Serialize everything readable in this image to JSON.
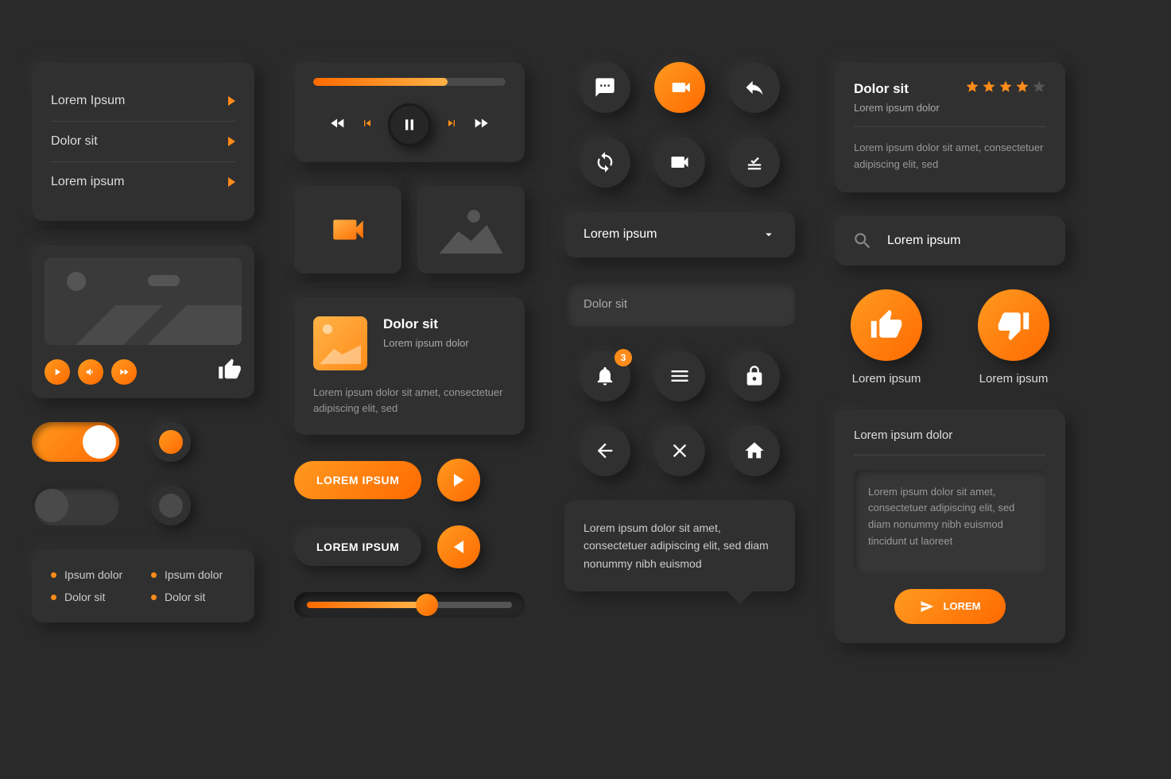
{
  "menu": {
    "items": [
      "Lorem Ipsum",
      "Dolor sit",
      "Lorem ipsum"
    ]
  },
  "bullets": [
    "Ipsum dolor",
    "Ipsum dolor",
    "Dolor sit",
    "Dolor sit"
  ],
  "player": {
    "progress": 70
  },
  "post": {
    "title": "Dolor sit",
    "subtitle": "Lorem ipsum dolor",
    "body": "Lorem ipsum dolor sit amet, consectetuer adipiscing elit, sed"
  },
  "buttons": {
    "primary": "LOREM IPSUM",
    "secondary": "LOREM IPSUM"
  },
  "slider": {
    "value": 55
  },
  "dropdown": {
    "label": "Lorem ipsum"
  },
  "input": {
    "placeholder": "Dolor sit"
  },
  "notification_badge": "3",
  "tooltip": "Lorem ipsum dolor sit amet, consectetuer adipiscing elit, sed diam nonummy nibh euismod",
  "review": {
    "title": "Dolor sit",
    "subtitle": "Lorem ipsum dolor",
    "body": "Lorem ipsum dolor sit amet, consectetuer adipiscing elit, sed",
    "rating": 4
  },
  "search": {
    "placeholder": "Lorem ipsum"
  },
  "vote": {
    "up_label": "Lorem ipsum",
    "down_label": "Lorem ipsum"
  },
  "comment": {
    "heading": "Lorem ipsum dolor",
    "body": "Lorem ipsum dolor sit amet, consectetuer adipiscing elit, sed diam nonummy nibh euismod tincidunt ut laoreet",
    "button": "LOREM"
  }
}
